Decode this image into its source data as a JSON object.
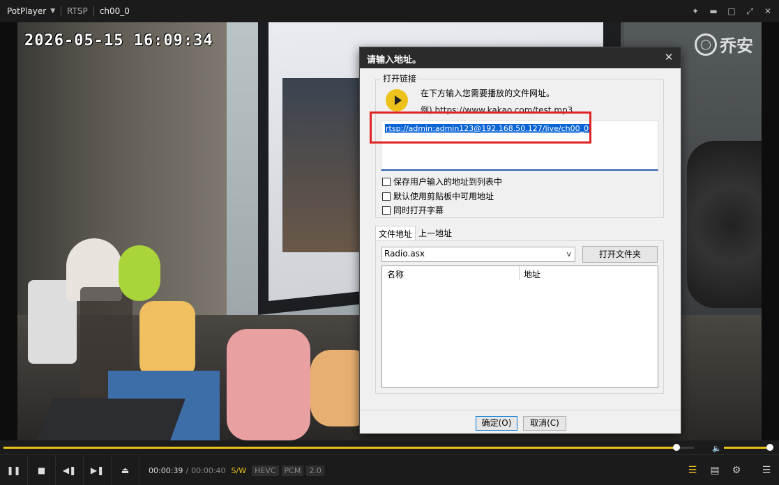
{
  "titlebar": {
    "app_name": "PotPlayer",
    "tabs": [
      "RTSP",
      "ch00_0"
    ]
  },
  "video": {
    "timestamp": "2026-05-15 16:09:34",
    "watermark": "乔安"
  },
  "dialog": {
    "title": "请输入地址。",
    "group_label": "打开链接",
    "hint": "在下方输入您需要播放的文件网址。",
    "example": "例) https://www.kakao.com/test.mp3",
    "url_value": "rtsp://admin:admin123@192.168.50.127/live/ch00_0",
    "checkboxes": [
      {
        "label": "保存用户输入的地址到列表中",
        "checked": false
      },
      {
        "label": "默认使用剪贴板中可用地址",
        "checked": false
      },
      {
        "label": "同时打开字幕",
        "checked": false
      }
    ],
    "tabs": [
      "文件地址",
      "上一地址"
    ],
    "combo_value": "Radio.asx",
    "open_folder_label": "打开文件夹",
    "columns": [
      "名称",
      "地址"
    ],
    "ok_label": "确定(O)",
    "cancel_label": "取消(C)"
  },
  "player": {
    "progress": 0.975,
    "volume": 1.0,
    "current_time": "00:00:39",
    "total_time": "00:00:40",
    "badges": [
      "S/W",
      "HEVC",
      "PCM",
      "2.0"
    ]
  },
  "colors": {
    "accent": "#e8c21a",
    "highlight_box": "#e02424",
    "selection": "#0a64d6"
  }
}
